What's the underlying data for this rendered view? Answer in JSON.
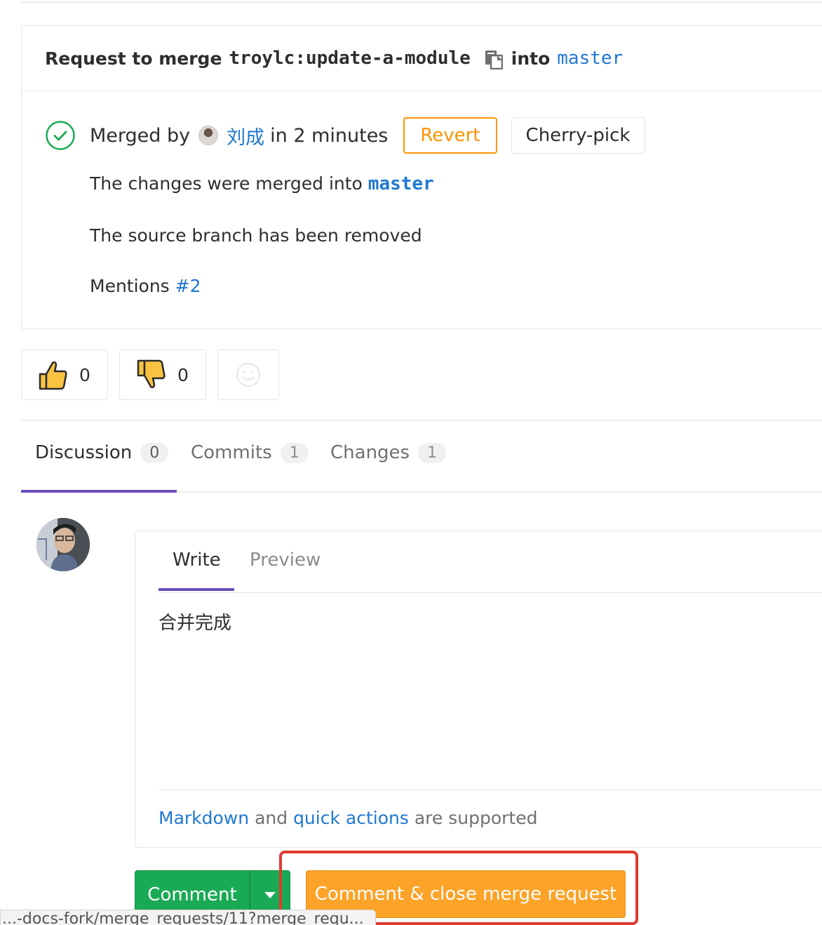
{
  "merge_request": {
    "header_prefix": "Request to merge",
    "source_branch": "troylc:update-a-module",
    "header_into": "into",
    "target_branch": "master"
  },
  "merge_status": {
    "merged_by_label": "Merged by",
    "user_name": "刘成",
    "duration": "in 2 minutes",
    "revert_label": "Revert",
    "cherry_pick_label": "Cherry-pick",
    "changes_text": "The changes were merged into",
    "changes_branch": "master",
    "source_removed_text": "The source branch has been removed",
    "mentions_label": "Mentions",
    "mentions_link": "#2"
  },
  "awards": {
    "thumbs_up_count": "0",
    "thumbs_down_count": "0"
  },
  "tabs": [
    {
      "label": "Discussion",
      "count": "0"
    },
    {
      "label": "Commits",
      "count": "1"
    },
    {
      "label": "Changes",
      "count": "1"
    }
  ],
  "editor": {
    "write_tab": "Write",
    "preview_tab": "Preview",
    "content": "合并完成",
    "hint_markdown": "Markdown",
    "hint_and": "and",
    "hint_quick_actions": "quick actions",
    "hint_suffix": "are supported"
  },
  "actions": {
    "comment_label": "Comment",
    "close_label": "Comment & close merge request"
  },
  "status_bar": {
    "url": "...-docs-fork/merge_requests/11?merge_requ..."
  },
  "colors": {
    "link": "#1f78d1",
    "success": "#1aaa55",
    "warning": "#fc9403",
    "tab_active": "#6b4fbb",
    "highlight": "#e03a2f"
  }
}
